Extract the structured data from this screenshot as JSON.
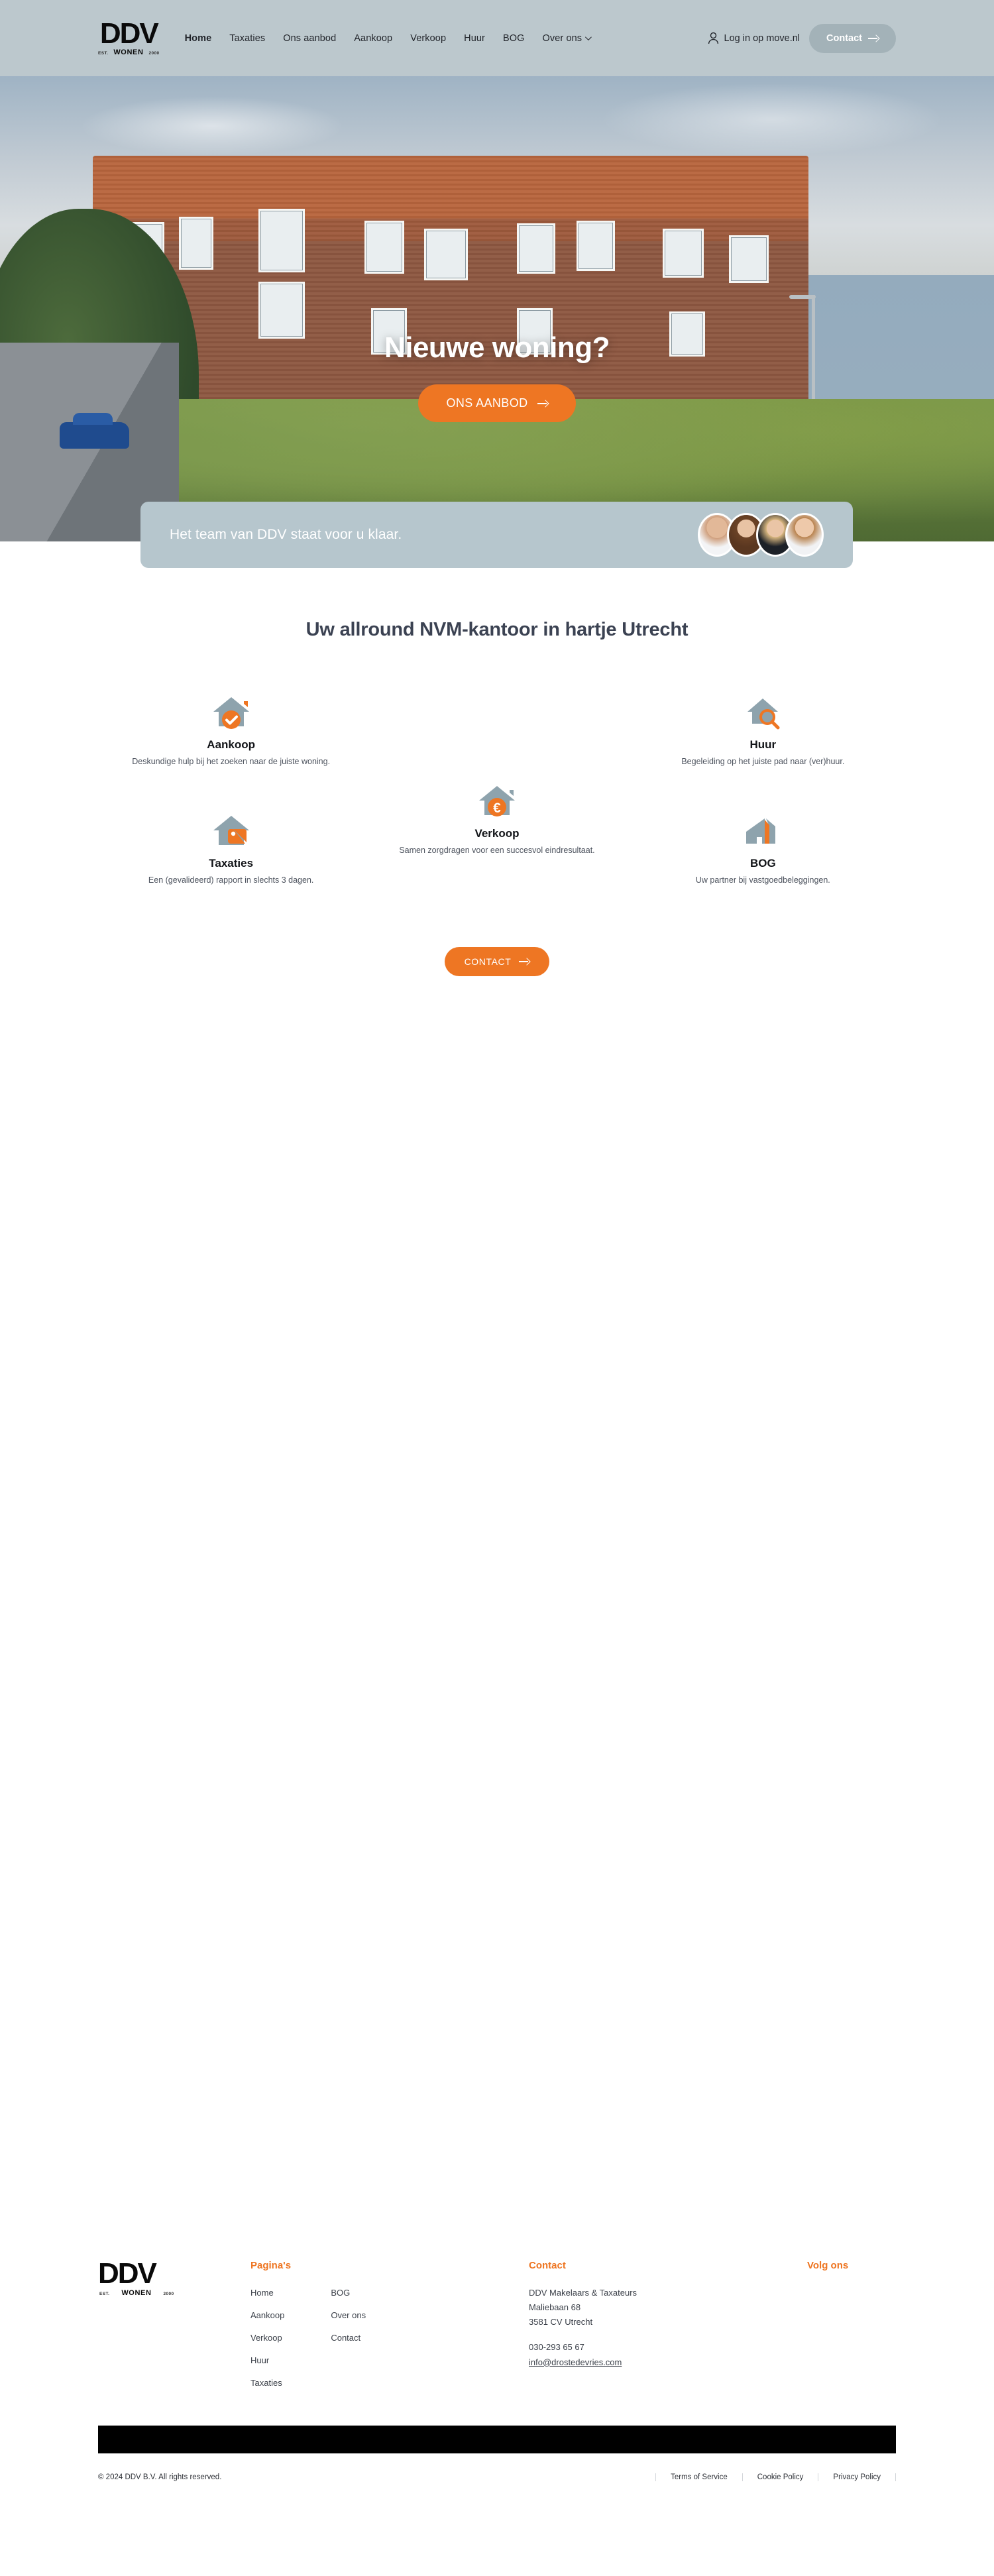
{
  "brand": {
    "logo_main": "DDV",
    "logo_est": "EST.",
    "logo_wonen": "WONEN",
    "logo_year": "2000",
    "accent_color": "#ee7623",
    "header_bg": "#bcc8cd",
    "banner_bg": "#b6c6cd"
  },
  "header": {
    "nav": [
      {
        "label": "Home",
        "active": true
      },
      {
        "label": "Taxaties",
        "active": false
      },
      {
        "label": "Ons aanbod",
        "active": false
      },
      {
        "label": "Aankoop",
        "active": false
      },
      {
        "label": "Verkoop",
        "active": false
      },
      {
        "label": "Huur",
        "active": false
      },
      {
        "label": "BOG",
        "active": false
      },
      {
        "label": "Over ons",
        "active": false,
        "has_dropdown": true
      }
    ],
    "login_label": "Log in op move.nl",
    "login_icon": "user-icon",
    "contact_label": "Contact",
    "contact_icon": "arrow-right-icon"
  },
  "hero": {
    "title": "Nieuwe woning?",
    "cta_label": "ONS AANBOD",
    "cta_icon": "arrow-right-icon",
    "carousel_dots": 4,
    "carousel_active_index": 0
  },
  "team_banner": {
    "text": "Het team van DDV staat voor u klaar.",
    "avatar_count": 4
  },
  "services": {
    "section_title": "Uw allround NVM-kantoor in hartje Utrecht",
    "left": [
      {
        "icon": "house-check-icon",
        "name": "Aankoop",
        "desc": "Deskundige hulp bij het zoeken naar de juiste woning."
      },
      {
        "icon": "house-tag-icon",
        "name": "Taxaties",
        "desc": "Een (gevalideerd) rapport in slechts 3 dagen."
      }
    ],
    "middle": [
      {
        "icon": "house-euro-icon",
        "name": "Verkoop",
        "desc": "Samen zorgdragen voor een succesvol eindresultaat."
      }
    ],
    "right": [
      {
        "icon": "house-search-icon",
        "name": "Huur",
        "desc": "Begeleiding op het juiste pad naar (ver)huur."
      },
      {
        "icon": "buildings-icon",
        "name": "BOG",
        "desc": "Uw partner bij vastgoedbeleggingen."
      }
    ],
    "cta_label": "CONTACT",
    "cta_icon": "arrow-right-icon"
  },
  "footer": {
    "pages_title": "Pagina's",
    "pages_col1": [
      "Home",
      "Aankoop",
      "Verkoop",
      "Huur",
      "Taxaties"
    ],
    "pages_col2": [
      "BOG",
      "Over ons",
      "Contact"
    ],
    "contact_title": "Contact",
    "contact_lines": [
      "DDV Makelaars & Taxateurs",
      "Maliebaan 68",
      "3581 CV Utrecht"
    ],
    "phone": "030-293 65 67",
    "email": "info@drostedevries.com",
    "follow_title": "Volg ons"
  },
  "legal": {
    "copyright": "© 2024 DDV B.V. All rights reserved.",
    "links": [
      "Terms of Service",
      "Cookie Policy",
      "Privacy Policy"
    ]
  }
}
